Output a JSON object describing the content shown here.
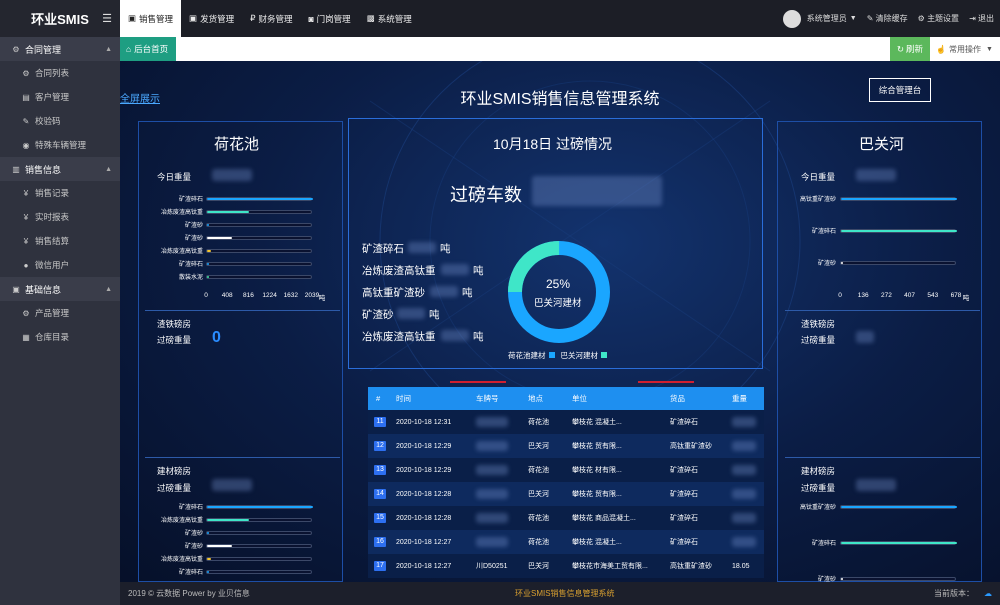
{
  "brand": {
    "title": "环业SMIS",
    "menu_icon": "menu-icon"
  },
  "sidebar": {
    "groups": [
      {
        "label": "合同管理",
        "icon": "gears-icon",
        "items": [
          {
            "label": "合同列表",
            "icon": "gears-icon"
          },
          {
            "label": "客户管理",
            "icon": "idcard-icon"
          },
          {
            "label": "校验码",
            "icon": "wrench-icon"
          },
          {
            "label": "特殊车辆管理",
            "icon": "compass-icon"
          }
        ]
      },
      {
        "label": "销售信息",
        "icon": "document-icon",
        "items": [
          {
            "label": "销售记录",
            "icon": "yen-icon"
          },
          {
            "label": "实时报表",
            "icon": "yen-icon"
          },
          {
            "label": "销售结算",
            "icon": "yen-icon"
          },
          {
            "label": "微信用户",
            "icon": "user-circle-icon"
          }
        ]
      },
      {
        "label": "基础信息",
        "icon": "truck-icon",
        "items": [
          {
            "label": "产品管理",
            "icon": "gears-icon"
          },
          {
            "label": "仓库目录",
            "icon": "book-icon"
          }
        ]
      }
    ]
  },
  "topnav": {
    "tabs": [
      {
        "label": "销售管理",
        "icon": "truck-icon"
      },
      {
        "label": "发货管理",
        "icon": "truck-icon"
      },
      {
        "label": "财务管理",
        "icon": "ruble-icon"
      },
      {
        "label": "门岗管理",
        "icon": "camera-icon"
      },
      {
        "label": "系统管理",
        "icon": "image-icon"
      }
    ],
    "user": "系统管理员",
    "clear_cache": "清除缓存",
    "theme": "主题设置",
    "logout": "退出"
  },
  "tabbar": {
    "home": "后台首页",
    "refresh": "刷新",
    "ops": "常用操作"
  },
  "dashboard": {
    "title": "环业SMIS销售信息管理系统",
    "fullscreen": "全屏展示",
    "console": "综合管理台",
    "left": {
      "name": "荷花池",
      "today_weight": "今日重量",
      "sec2": "渣铁磅房",
      "sec2_weight": "过磅重量",
      "sec2_value": "0",
      "sec3": "建材磅房",
      "sec3_weight": "过磅重量",
      "bars": [
        {
          "label": "矿渣碎石",
          "value": 2039,
          "color": "#1aa6ff"
        },
        {
          "label": "冶炼废渣高钛重",
          "value": 816,
          "color": "#3fe6c8"
        },
        {
          "label": "矿渣砂",
          "value": 0,
          "color": "#1aa6ff"
        },
        {
          "label": "矿渣砂",
          "value": 480,
          "color": "#ffffff"
        },
        {
          "label": "冶炼废渣高钛重",
          "value": 80,
          "color": "#f2c530"
        },
        {
          "label": "矿渣碎石",
          "value": 0,
          "color": "#1aa6ff"
        },
        {
          "label": "散装水泥",
          "value": 20,
          "color": "#3fe6a0"
        }
      ],
      "ticks": [
        "0",
        "408",
        "816",
        "1224",
        "1632",
        "2039",
        "吨"
      ],
      "bars2": [
        {
          "label": "矿渣碎石",
          "value": 2039,
          "color": "#1aa6ff"
        },
        {
          "label": "冶炼废渣高钛重",
          "value": 816,
          "color": "#3fe6c8"
        },
        {
          "label": "矿渣砂",
          "value": 0,
          "color": "#1aa6ff"
        },
        {
          "label": "矿渣砂",
          "value": 480,
          "color": "#ffffff"
        },
        {
          "label": "冶炼废渣高钛重",
          "value": 80,
          "color": "#f2c530"
        },
        {
          "label": "矿渣碎石",
          "value": 0,
          "color": "#1aa6ff"
        }
      ]
    },
    "center": {
      "heading": "10月18日 过磅情况",
      "count_label": "过磅车数",
      "items": [
        {
          "name": "矿渣碎石",
          "unit": "吨"
        },
        {
          "name": "冶炼废渣高钛重",
          "unit": "吨"
        },
        {
          "name": "高钛重矿渣砂",
          "unit": "吨"
        },
        {
          "name": "矿渣砂",
          "unit": "吨"
        },
        {
          "name": "冶炼废渣高钛重",
          "unit": "吨"
        }
      ],
      "donut": {
        "percent_text": "25%",
        "center_label": "巴关河建材",
        "percent": 25,
        "color_a": "#3fe6c8",
        "color_b": "#1aa6ff",
        "legend": [
          {
            "label": "荷花池建材",
            "color": "#1aa6ff"
          },
          {
            "label": "巴关河建材",
            "color": "#3fe6c8"
          }
        ]
      }
    },
    "right": {
      "name": "巴关河",
      "today_weight": "今日重量",
      "sec2": "渣铁磅房",
      "sec2_weight": "过磅重量",
      "sec3": "建材磅房",
      "sec3_weight": "过磅重量",
      "bars": [
        {
          "label": "高钛重矿渣砂",
          "value": 678,
          "color": "#1aa6ff"
        },
        {
          "label": "矿渣碎石",
          "value": 678,
          "color": "#3fe6c8"
        },
        {
          "label": "矿渣砂",
          "value": 8,
          "color": "#ffffff"
        }
      ],
      "ticks": [
        "0",
        "136",
        "272",
        "407",
        "543",
        "678",
        "吨"
      ],
      "bars2": [
        {
          "label": "高钛重矿渣砂",
          "value": 678,
          "color": "#1aa6ff"
        },
        {
          "label": "矿渣碎石",
          "value": 678,
          "color": "#3fe6c8"
        },
        {
          "label": "矿渣砂",
          "value": 8,
          "color": "#ffffff"
        }
      ]
    },
    "table": {
      "headers": [
        "#",
        "时间",
        "车牌号",
        "地点",
        "单位",
        "货品",
        "重量"
      ],
      "rows": [
        {
          "n": "11",
          "time": "2020-10-18 12:31",
          "plate": "",
          "place": "荷花池",
          "unit": "攀枝花  混凝土...",
          "goods": "矿渣碎石",
          "weight": ""
        },
        {
          "n": "12",
          "time": "2020-10-18 12:29",
          "plate": "",
          "place": "巴关河",
          "unit": "攀枝花  贸有限...",
          "goods": "高钛重矿渣砂",
          "weight": ""
        },
        {
          "n": "13",
          "time": "2020-10-18 12:29",
          "plate": "",
          "place": "荷花池",
          "unit": "攀枝花  材有限...",
          "goods": "矿渣碎石",
          "weight": ""
        },
        {
          "n": "14",
          "time": "2020-10-18 12:28",
          "plate": "",
          "place": "巴关河",
          "unit": "攀枝花  贸有限...",
          "goods": "矿渣碎石",
          "weight": ""
        },
        {
          "n": "15",
          "time": "2020-10-18 12:28",
          "plate": "",
          "place": "荷花池",
          "unit": "攀枝花  商品混凝土...",
          "goods": "矿渣碎石",
          "weight": ""
        },
        {
          "n": "16",
          "time": "2020-10-18 12:27",
          "plate": "",
          "place": "荷花池",
          "unit": "攀枝花  混凝土...",
          "goods": "矿渣碎石",
          "weight": ""
        },
        {
          "n": "17",
          "time": "2020-10-18 12:27",
          "plate": "川D50251",
          "place": "巴关河",
          "unit": "攀枝花市海美工贸有限...",
          "goods": "高钛重矿渣砂",
          "weight": "18.05"
        }
      ]
    }
  },
  "footer": {
    "left": "2019 © 云数据 Power by 业贝信息",
    "center": "环业SMIS销售信息管理系统",
    "right": "当前版本："
  }
}
